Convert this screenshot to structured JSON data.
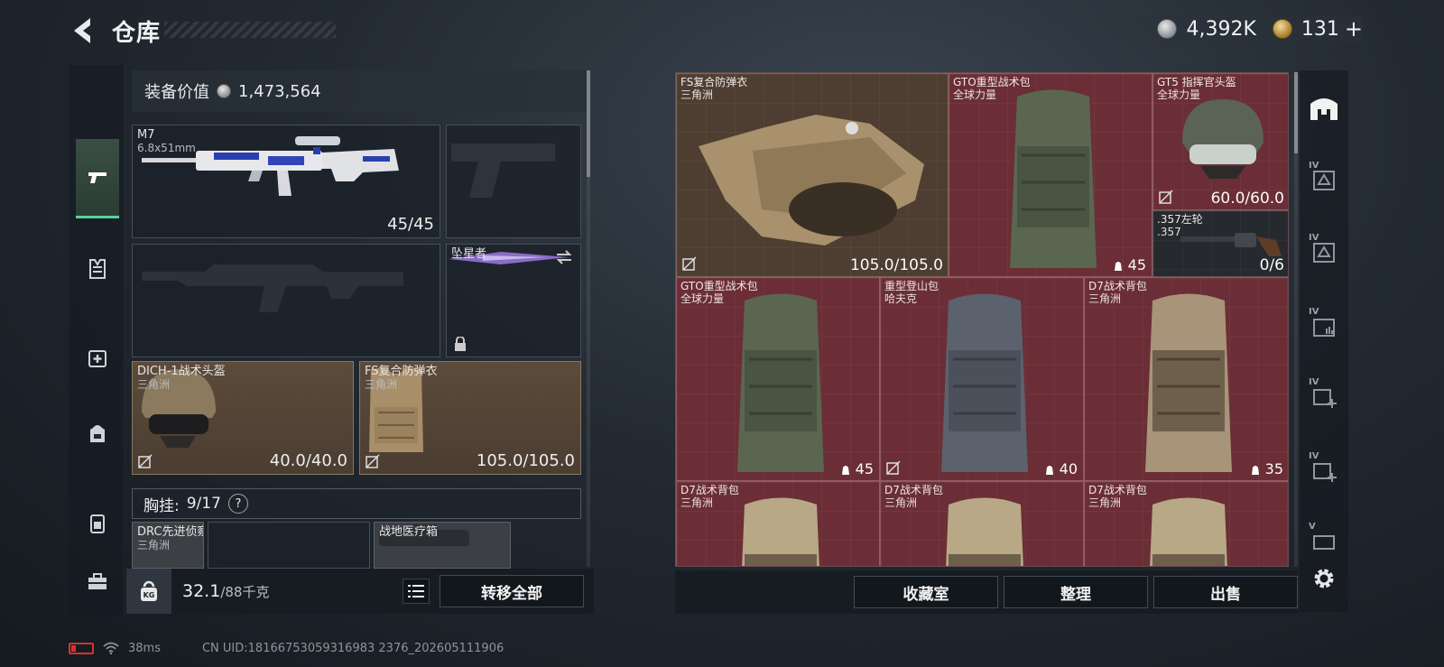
{
  "header": {
    "title": "仓库",
    "currency_silver": "4,392K",
    "currency_gold": "131",
    "plus": "+"
  },
  "left_nav": {
    "items": [
      "pistol-icon",
      "vest-icon",
      "medkit-icon",
      "backpack-icon",
      "chest-rig-icon",
      "toolbox-icon"
    ]
  },
  "equipment": {
    "value_label": "装备价值",
    "value": "1,473,564",
    "primary_weapon": {
      "name": "M7",
      "ammo": "6.8x51mm",
      "count": "45/45"
    },
    "melee": {
      "name": "坠星者"
    },
    "helmet": {
      "name": "DICH-1战术头盔",
      "origin": "三角洲",
      "durability": "40.0/40.0"
    },
    "armor": {
      "name": "FS复合防弹衣",
      "origin": "三角洲",
      "durability": "105.0/105.0"
    },
    "chest_rig": {
      "label": "胸挂:",
      "value": "9/17",
      "help": "?"
    },
    "rig_items": [
      {
        "name": "DRC先进侦察...",
        "origin": "三角洲"
      },
      {
        "name": "战地医疗箱"
      }
    ],
    "weight": "32.1",
    "weight_max": "/88千克",
    "kg_label": "KG",
    "transfer_all": "转移全部"
  },
  "grid": {
    "cells": [
      {
        "name": "FS复合防弹衣",
        "origin": "三角洲",
        "value": "105.0/105.0"
      },
      {
        "name": "GTO重型战术包",
        "origin": "全球力量",
        "value": "45"
      },
      {
        "name": "GT5 指挥官头盔",
        "origin": "全球力量",
        "value": "60.0/60.0"
      },
      {
        "name": ".357左轮",
        "origin": ".357",
        "value": "0/6"
      },
      {
        "name": "GTO重型战术包",
        "origin": "全球力量",
        "value": "45"
      },
      {
        "name": "重型登山包",
        "origin": "哈夫克",
        "value": "40"
      },
      {
        "name": "D7战术背包",
        "origin": "三角洲",
        "value": "35"
      },
      {
        "name": "D7战术背包",
        "origin": "三角洲"
      },
      {
        "name": "D7战术背包",
        "origin": "三角洲"
      },
      {
        "name": "D7战术背包",
        "origin": "三角洲"
      }
    ]
  },
  "right_nav": {
    "tags": [
      "IV",
      "IV",
      "IV",
      "IV",
      "IV",
      "V"
    ]
  },
  "actions": {
    "collection": "收藏室",
    "sort": "整理",
    "sell": "出售"
  },
  "status": {
    "ping": "38ms",
    "uid": "CN UID:18166753059316983 2376_202605111906"
  },
  "colors": {
    "accent_green": "#55d39a",
    "cell_red": "#6b2e36",
    "cell_brown": "#4e3e31"
  }
}
